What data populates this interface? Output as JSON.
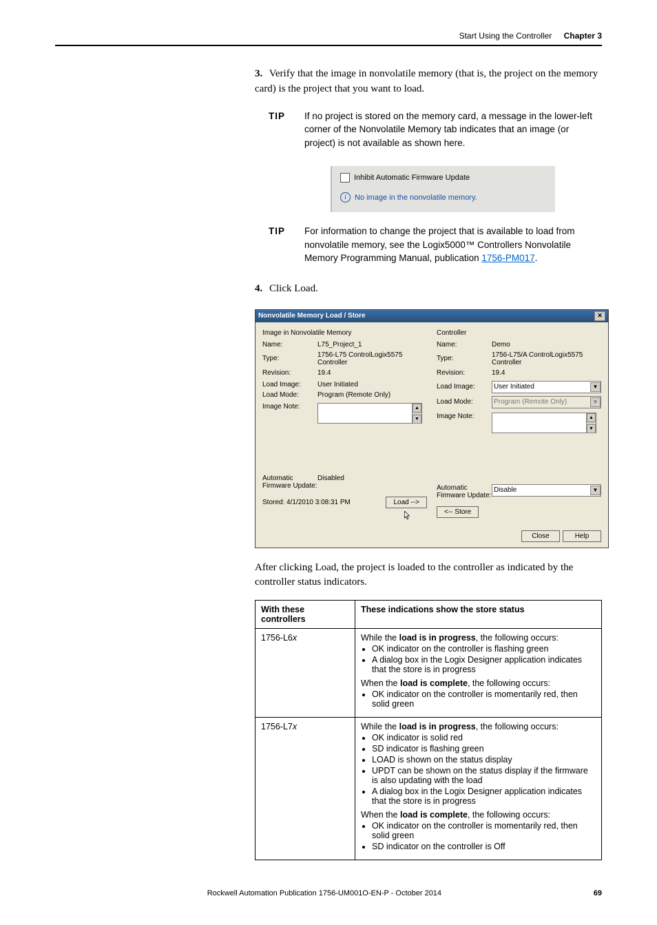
{
  "header": {
    "title": "Start Using the Controller",
    "chapter": "Chapter 3"
  },
  "step3": {
    "num": "3.",
    "text": "Verify that the image in nonvolatile memory (that is, the project on the memory card) is the project that you want to load."
  },
  "tip1": {
    "label": "TIP",
    "text": "If no project is stored on the memory card, a message in the lower-left corner of the Nonvolatile Memory tab indicates that an image (or project) is not available as shown here."
  },
  "greySnippet": {
    "checkbox": "Inhibit Automatic Firmware Update",
    "info": "No image in the nonvolatile memory."
  },
  "tip2": {
    "label": "TIP",
    "text_before": "For information to change the project that is available to load from nonvolatile memory, see the Logix5000™ Controllers Nonvolatile Memory Programming Manual, publication ",
    "link": "1756-PM017",
    "text_after": "."
  },
  "step4": {
    "num": "4.",
    "text": "Click Load."
  },
  "dialog": {
    "title": "Nonvolatile Memory Load / Store",
    "left": {
      "header": "Image in Nonvolatile Memory",
      "name_lbl": "Name:",
      "name_val": "L75_Project_1",
      "type_lbl": "Type:",
      "type_val": "1756-L75 ControlLogix5575 Controller",
      "rev_lbl": "Revision:",
      "rev_val": "19.4",
      "loadimg_lbl": "Load Image:",
      "loadimg_val": "User Initiated",
      "loadmode_lbl": "Load Mode:",
      "loadmode_val": "Program (Remote Only)",
      "imgnote_lbl": "Image Note:",
      "afw_lbl": "Automatic\nFirmware Update:",
      "afw_val": "Disabled",
      "stored": "Stored:  4/1/2010  3:08:31 PM",
      "load_btn": "Load -->"
    },
    "right": {
      "header": "Controller",
      "name_lbl": "Name:",
      "name_val": "Demo",
      "type_lbl": "Type:",
      "type_val": "1756-L75/A ControlLogix5575 Controller",
      "rev_lbl": "Revision:",
      "rev_val": "19.4",
      "loadimg_lbl": "Load Image:",
      "loadimg_val": "User Initiated",
      "loadmode_lbl": "Load Mode:",
      "loadmode_val": "Program (Remote Only)",
      "imgnote_lbl": "Image Note:",
      "afw_lbl": "Automatic\nFirmware Update:",
      "afw_val": "Disable",
      "store_btn": "<-- Store"
    },
    "close_btn": "Close",
    "help_btn": "Help"
  },
  "afterPara": "After clicking Load, the project is loaded to the controller as indicated by the controller status indicators.",
  "table": {
    "col1": "With these controllers",
    "col2": "These indications show the store status",
    "rows": [
      {
        "ctrl": "1756-L6x",
        "prog_intro": "While the ",
        "prog_bold": "load is in progress",
        "prog_after": ", the following occurs:",
        "prog_bullets": [
          "OK indicator on the controller is flashing green",
          "A dialog box in the Logix Designer application indicates that the store is in progress"
        ],
        "done_intro": "When the ",
        "done_bold": "load is complete",
        "done_after": ", the following occurs:",
        "done_bullets": [
          "OK indicator on the controller is momentarily red, then solid green"
        ]
      },
      {
        "ctrl": "1756-L7x",
        "prog_intro": "While the ",
        "prog_bold": "load is in progress",
        "prog_after": ", the following occurs:",
        "prog_bullets": [
          "OK indicator is solid red",
          "SD indicator is flashing green",
          "LOAD is shown on the status display",
          "UPDT can be shown on the status display if the firmware is also updating with the load",
          "A dialog box in the Logix Designer application indicates that the store is in progress"
        ],
        "done_intro": "When the ",
        "done_bold": "load is complete",
        "done_after": ", the following occurs:",
        "done_bullets": [
          "OK indicator on the controller is momentarily red, then solid green",
          "SD indicator on the controller is Off"
        ]
      }
    ]
  },
  "footer": {
    "pub": "Rockwell Automation Publication 1756-UM001O-EN-P - October 2014",
    "page": "69"
  }
}
